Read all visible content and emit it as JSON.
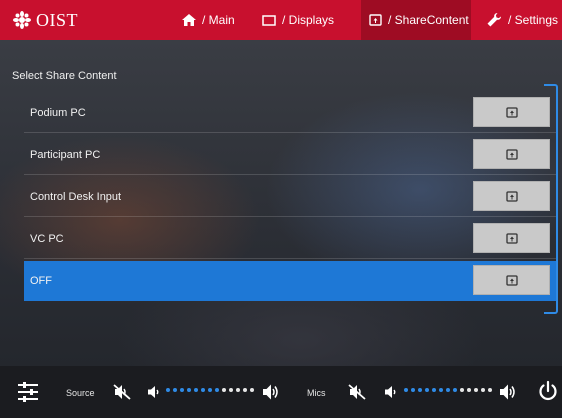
{
  "header": {
    "brand": "OIST",
    "tabs": [
      {
        "label": "/ Main",
        "icon": "home-icon"
      },
      {
        "label": "/ Displays",
        "icon": "display-icon"
      },
      {
        "label": "/ ShareContent",
        "icon": "share-content-icon",
        "active": true
      },
      {
        "label": "/ Settings",
        "icon": "wrench-icon"
      }
    ]
  },
  "share": {
    "title": "Select Share Content",
    "sources": [
      {
        "label": "Podium PC",
        "selected": false
      },
      {
        "label": "Participant PC",
        "selected": false
      },
      {
        "label": "Control Desk Input",
        "selected": false
      },
      {
        "label": "VC PC",
        "selected": false
      },
      {
        "label": "OFF",
        "selected": true
      }
    ]
  },
  "footer": {
    "source_label": "Source",
    "mics_label": "Mics",
    "source_volume_level": 0.6,
    "mics_volume_level": 0.6
  },
  "colors": {
    "header_red": "#c8102e",
    "active_tab": "#9e0c23",
    "accent_blue": "#1e78d6",
    "footer_bg": "#1b1c20"
  }
}
